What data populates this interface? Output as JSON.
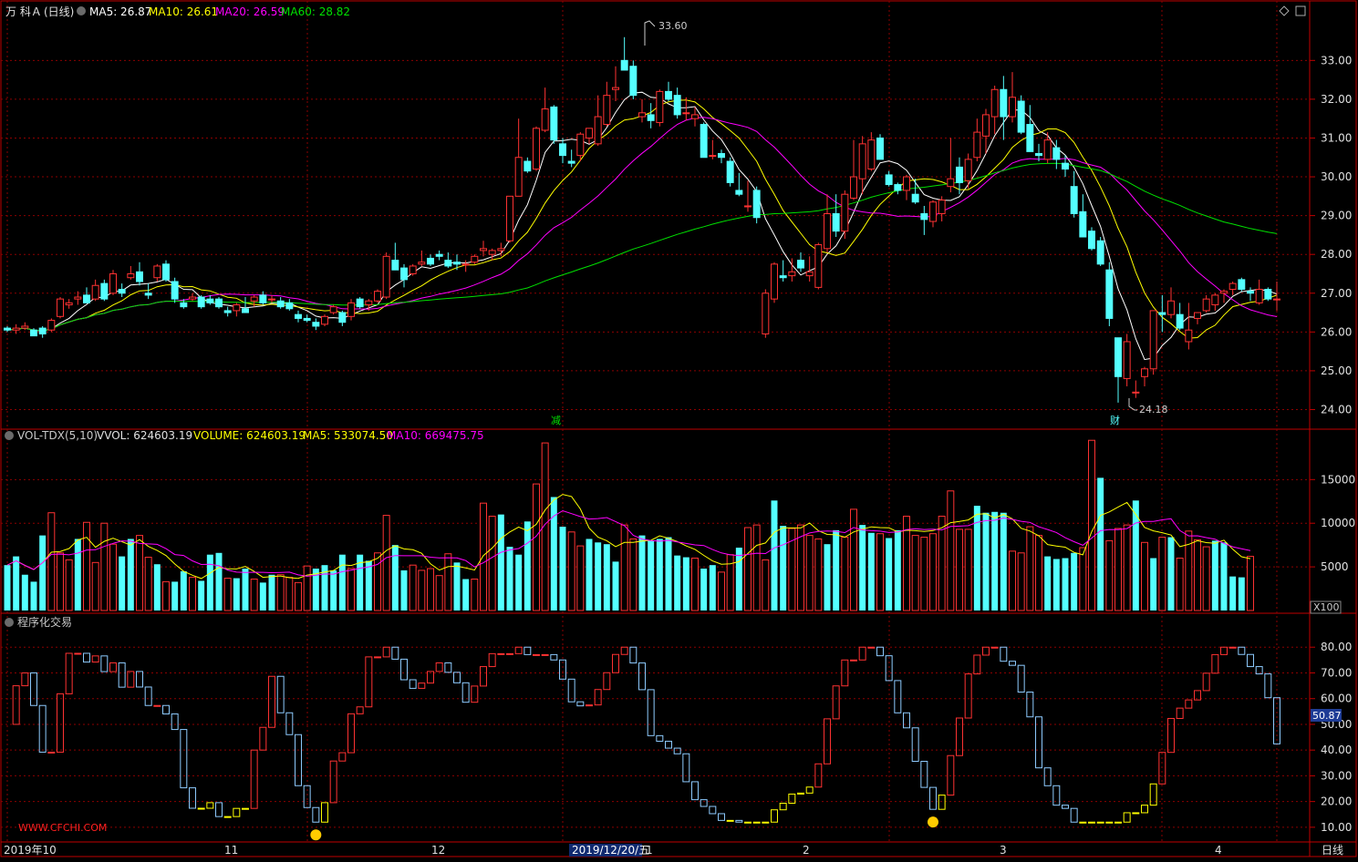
{
  "header": {
    "symbol": "万 科Ａ",
    "period": "(日线)",
    "ma5": "MA5: 26.87",
    "ma10": "MA10: 26.61",
    "ma20": "MA20: 26.59",
    "ma60": "MA60: 28.82"
  },
  "vol_header": {
    "name": "VOL-TDX(5,10)",
    "vvol": "VVOL: 624603.19",
    "volume": "VOLUME: 624603.19",
    "ma5": "MA5: 533074.50",
    "ma10": "MA10: 669475.75"
  },
  "ind_header": {
    "name": "程序化交易"
  },
  "markers": {
    "high": "33.60",
    "low": "24.18",
    "jian": "减",
    "cai": "财"
  },
  "watermark": "WWW.CFCHI.COM",
  "period_label": "日线",
  "colors": {
    "up": "#ff3232",
    "down": "#54ffff",
    "ma5": "#ffffff",
    "ma10": "#ffff00",
    "ma20": "#ff00ff",
    "ma60": "#00e000",
    "grid": "#8b0000",
    "axis": "#c00000"
  },
  "chart_data": [
    {
      "type": "candlestick",
      "title": "万 科Ａ (日线)",
      "ylim": [
        23.8,
        33.9
      ],
      "y_ticks": [
        "24.00",
        "25.00",
        "26.00",
        "27.00",
        "28.00",
        "29.00",
        "30.00",
        "31.00",
        "32.00",
        "33.00"
      ],
      "x_labels": [
        "2019年10",
        "11",
        "12",
        "2019/12/20/五",
        "1",
        "2",
        "3",
        "4"
      ],
      "ohlc": [
        [
          26.1,
          26.15,
          26.0,
          26.05
        ],
        [
          26.05,
          26.2,
          25.95,
          26.1
        ],
        [
          26.1,
          26.25,
          26.05,
          26.15
        ],
        [
          26.05,
          26.1,
          25.9,
          25.9
        ],
        [
          26.1,
          26.15,
          25.85,
          25.95
        ],
        [
          26.05,
          26.35,
          26.0,
          26.3
        ],
        [
          26.4,
          26.9,
          26.35,
          26.85
        ],
        [
          26.7,
          26.85,
          26.6,
          26.75
        ],
        [
          26.85,
          27.05,
          26.7,
          26.9
        ],
        [
          26.95,
          27.15,
          26.75,
          26.75
        ],
        [
          26.85,
          27.35,
          26.8,
          27.2
        ],
        [
          27.25,
          27.35,
          26.8,
          26.85
        ],
        [
          27.0,
          27.6,
          26.95,
          27.5
        ],
        [
          27.1,
          27.25,
          26.9,
          27.0
        ],
        [
          27.4,
          27.7,
          27.35,
          27.5
        ],
        [
          27.55,
          27.8,
          27.2,
          27.3
        ],
        [
          27.0,
          27.25,
          26.85,
          26.95
        ],
        [
          27.4,
          27.75,
          27.3,
          27.7
        ],
        [
          27.75,
          27.85,
          27.3,
          27.35
        ],
        [
          27.3,
          27.4,
          26.75,
          26.85
        ],
        [
          26.75,
          26.85,
          26.6,
          26.65
        ],
        [
          26.85,
          27.0,
          26.8,
          26.9
        ],
        [
          26.9,
          26.95,
          26.6,
          26.65
        ],
        [
          26.85,
          26.95,
          26.7,
          26.75
        ],
        [
          26.85,
          26.9,
          26.6,
          26.65
        ],
        [
          26.55,
          26.65,
          26.4,
          26.5
        ],
        [
          26.55,
          26.75,
          26.4,
          26.7
        ],
        [
          26.6,
          26.9,
          26.5,
          26.5
        ],
        [
          26.8,
          26.95,
          26.65,
          26.9
        ],
        [
          26.95,
          27.05,
          26.7,
          26.75
        ],
        [
          26.85,
          26.95,
          26.75,
          26.85
        ],
        [
          26.8,
          26.9,
          26.6,
          26.65
        ],
        [
          26.75,
          26.85,
          26.55,
          26.6
        ],
        [
          26.45,
          26.55,
          26.25,
          26.35
        ],
        [
          26.35,
          26.45,
          26.25,
          26.3
        ],
        [
          26.25,
          26.35,
          26.05,
          26.15
        ],
        [
          26.2,
          26.45,
          26.15,
          26.4
        ],
        [
          26.5,
          26.7,
          26.45,
          26.65
        ],
        [
          26.5,
          26.55,
          26.15,
          26.25
        ],
        [
          26.4,
          26.85,
          26.3,
          26.75
        ],
        [
          26.85,
          26.9,
          26.6,
          26.65
        ],
        [
          26.7,
          26.85,
          26.55,
          26.8
        ],
        [
          26.8,
          27.1,
          26.75,
          27.05
        ],
        [
          26.9,
          28.05,
          26.85,
          27.95
        ],
        [
          27.85,
          28.3,
          27.6,
          27.6
        ],
        [
          27.65,
          27.75,
          27.15,
          27.35
        ],
        [
          27.5,
          27.75,
          27.45,
          27.7
        ],
        [
          27.75,
          28.1,
          27.7,
          27.8
        ],
        [
          27.9,
          28.0,
          27.7,
          27.75
        ],
        [
          28.0,
          28.1,
          27.85,
          27.95
        ],
        [
          27.85,
          28.05,
          27.65,
          27.7
        ],
        [
          27.8,
          28.0,
          27.6,
          27.75
        ],
        [
          27.75,
          27.85,
          27.55,
          27.75
        ],
        [
          27.8,
          28.0,
          27.75,
          27.95
        ],
        [
          28.1,
          28.35,
          27.95,
          28.15
        ],
        [
          28.0,
          28.15,
          27.85,
          28.1
        ],
        [
          28.1,
          28.3,
          27.95,
          28.15
        ],
        [
          28.35,
          29.5,
          28.3,
          29.5
        ],
        [
          29.5,
          31.5,
          29.5,
          30.5
        ],
        [
          30.4,
          30.5,
          30.1,
          30.15
        ],
        [
          30.2,
          31.3,
          30.15,
          31.25
        ],
        [
          31.2,
          32.3,
          31.15,
          31.75
        ],
        [
          31.8,
          31.85,
          30.85,
          30.95
        ],
        [
          30.85,
          31.0,
          30.35,
          30.55
        ],
        [
          30.4,
          30.7,
          30.25,
          30.35
        ],
        [
          30.55,
          31.15,
          30.4,
          31.1
        ],
        [
          31.0,
          31.25,
          30.85,
          31.25
        ],
        [
          30.85,
          32.1,
          30.8,
          31.55
        ],
        [
          31.35,
          32.45,
          31.3,
          32.1
        ],
        [
          32.25,
          32.85,
          31.95,
          32.3
        ],
        [
          33.0,
          33.6,
          32.75,
          32.75
        ],
        [
          32.85,
          33.0,
          32.0,
          32.1
        ],
        [
          31.55,
          32.0,
          31.4,
          31.65
        ],
        [
          31.6,
          31.9,
          31.25,
          31.45
        ],
        [
          31.4,
          32.25,
          31.3,
          32.2
        ],
        [
          32.2,
          32.45,
          31.95,
          32.0
        ],
        [
          32.1,
          32.3,
          31.5,
          31.6
        ],
        [
          31.65,
          32.05,
          31.45,
          31.65
        ],
        [
          31.5,
          31.8,
          31.3,
          31.6
        ],
        [
          31.35,
          31.4,
          30.5,
          30.5
        ],
        [
          30.55,
          30.95,
          30.45,
          30.55
        ],
        [
          30.6,
          30.7,
          30.35,
          30.5
        ],
        [
          30.4,
          30.5,
          29.75,
          29.85
        ],
        [
          29.65,
          30.1,
          29.5,
          29.55
        ],
        [
          29.25,
          29.9,
          29.1,
          29.25
        ],
        [
          29.65,
          29.75,
          28.8,
          28.95
        ],
        [
          25.95,
          27.1,
          25.85,
          27.0
        ],
        [
          26.85,
          27.8,
          26.75,
          27.75
        ],
        [
          27.45,
          27.85,
          27.3,
          27.4
        ],
        [
          27.45,
          27.9,
          27.3,
          27.55
        ],
        [
          27.85,
          28.05,
          27.55,
          27.65
        ],
        [
          27.45,
          27.95,
          27.3,
          27.55
        ],
        [
          27.15,
          28.3,
          27.1,
          28.25
        ],
        [
          28.15,
          29.55,
          28.05,
          29.05
        ],
        [
          29.05,
          29.55,
          28.45,
          28.6
        ],
        [
          28.6,
          29.65,
          28.4,
          29.55
        ],
        [
          29.45,
          30.95,
          29.4,
          30.0
        ],
        [
          29.95,
          31.05,
          29.55,
          30.85
        ],
        [
          30.2,
          31.15,
          30.15,
          30.95
        ],
        [
          31.0,
          31.1,
          30.45,
          30.45
        ],
        [
          30.05,
          30.15,
          29.75,
          29.8
        ],
        [
          29.8,
          29.85,
          29.55,
          29.65
        ],
        [
          29.65,
          30.05,
          29.4,
          30.0
        ],
        [
          29.55,
          29.95,
          29.3,
          29.35
        ],
        [
          29.05,
          29.25,
          28.5,
          28.9
        ],
        [
          28.85,
          29.4,
          28.7,
          29.35
        ],
        [
          29.05,
          29.5,
          28.85,
          29.4
        ],
        [
          29.75,
          31.0,
          29.6,
          29.95
        ],
        [
          30.25,
          30.5,
          29.55,
          29.85
        ],
        [
          29.9,
          30.6,
          29.7,
          30.45
        ],
        [
          30.5,
          31.5,
          30.4,
          31.15
        ],
        [
          31.05,
          31.75,
          30.6,
          31.6
        ],
        [
          31.55,
          32.35,
          31.1,
          32.25
        ],
        [
          32.25,
          32.6,
          30.95,
          31.55
        ],
        [
          31.55,
          32.7,
          31.4,
          32.05
        ],
        [
          31.95,
          32.1,
          31.1,
          31.15
        ],
        [
          31.35,
          31.85,
          30.85,
          30.65
        ],
        [
          30.6,
          30.85,
          30.4,
          30.55
        ],
        [
          30.45,
          31.15,
          30.35,
          30.95
        ],
        [
          30.75,
          30.95,
          30.2,
          30.45
        ],
        [
          30.35,
          30.55,
          30.0,
          30.2
        ],
        [
          29.75,
          30.15,
          28.95,
          29.05
        ],
        [
          29.1,
          29.55,
          28.65,
          28.45
        ],
        [
          28.6,
          28.7,
          28.1,
          28.15
        ],
        [
          28.35,
          28.45,
          27.7,
          27.75
        ],
        [
          27.6,
          27.8,
          26.15,
          26.35
        ],
        [
          25.85,
          25.85,
          24.18,
          24.85
        ],
        [
          24.8,
          25.95,
          24.6,
          25.75
        ],
        [
          24.45,
          24.75,
          24.3,
          24.45
        ],
        [
          24.85,
          25.1,
          24.6,
          25.05
        ],
        [
          25.05,
          26.55,
          24.9,
          26.55
        ],
        [
          26.5,
          26.95,
          26.0,
          26.45
        ],
        [
          26.45,
          27.15,
          26.35,
          26.8
        ],
        [
          26.45,
          26.75,
          26.05,
          26.1
        ],
        [
          25.75,
          26.75,
          25.55,
          26.05
        ],
        [
          26.35,
          26.5,
          26.2,
          26.5
        ],
        [
          26.55,
          26.95,
          26.5,
          26.85
        ],
        [
          26.7,
          27.0,
          26.55,
          26.95
        ],
        [
          27.0,
          27.1,
          26.75,
          27.05
        ],
        [
          27.1,
          27.3,
          26.95,
          27.25
        ],
        [
          27.35,
          27.4,
          27.05,
          27.1
        ],
        [
          27.05,
          27.15,
          26.8,
          27.0
        ],
        [
          26.75,
          27.35,
          26.7,
          27.1
        ],
        [
          27.1,
          27.15,
          26.8,
          26.85
        ],
        [
          26.85,
          27.3,
          26.55,
          26.85
        ]
      ],
      "overlays": [
        "MA5",
        "MA10",
        "MA20",
        "MA60"
      ]
    },
    {
      "type": "bar",
      "title": "VOL-TDX(5,10)",
      "unit": "X100",
      "ylim": [
        0,
        19000
      ],
      "y_ticks": [
        "5000",
        "10000",
        "15000"
      ],
      "values": [
        5200,
        6200,
        4100,
        3300,
        8600,
        11200,
        6600,
        5800,
        8200,
        10100,
        5500,
        10000,
        7600,
        6200,
        8200,
        8600,
        6100,
        5300,
        3300,
        3300,
        4500,
        3800,
        3400,
        6400,
        6600,
        3700,
        3700,
        4800,
        3600,
        3200,
        4100,
        4100,
        3800,
        3200,
        5100,
        4800,
        5200,
        4600,
        6400,
        4800,
        6400,
        5700,
        6600,
        10900,
        7500,
        4600,
        5200,
        4600,
        4800,
        4000,
        6500,
        5500,
        3600,
        3600,
        12300,
        10800,
        11000,
        7300,
        6400,
        10200,
        14500,
        19200,
        13000,
        9600,
        9000,
        7400,
        8200,
        7800,
        7600,
        5600,
        9800,
        8200,
        8600,
        8000,
        8200,
        8400,
        6300,
        6100,
        6000,
        4800,
        5200,
        4400,
        6400,
        7200,
        9500,
        9800,
        5800,
        12600,
        9700,
        9400,
        9800,
        8600,
        8200,
        7600,
        9200,
        8400,
        11600,
        9800,
        8900,
        8800,
        8300,
        9200,
        10800,
        8600,
        8400,
        8800,
        10800,
        13700,
        9300,
        9300,
        12000,
        11200,
        11300,
        11200,
        6800,
        6600,
        9600,
        8600,
        6200,
        5900,
        6000,
        6600,
        7200,
        19500,
        15200,
        8000,
        9400,
        9800,
        12600,
        7800,
        6000,
        8400,
        8400,
        6000,
        9100,
        8100,
        7300,
        8000,
        7800,
        3900,
        3800,
        6200
      ],
      "directions": "ddddduuuduuuudduududduddduddudduuuuddddudduudduuuuudduuudddduudduudddduuddddddudduuduuudduuuudduuddudduuuuuuuudddduuuudddduuduuudududuuuuddddududuuudd"
    },
    {
      "type": "bar",
      "title": "程序化交易",
      "ylim": [
        5,
        90
      ],
      "y_ticks": [
        "10.00",
        "20.00",
        "30.00",
        "40.00",
        "50.00",
        "60.00",
        "70.00",
        "80.00"
      ],
      "last_value": "50.87",
      "note": "hollow boxes: red rising, light-blue falling, yellow extreme; emoji at lows"
    }
  ]
}
